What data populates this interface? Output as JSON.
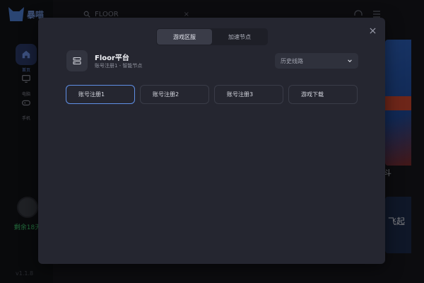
{
  "app": {
    "name": "暴喵",
    "version": "v1.1.8",
    "search_value": "FLOOR",
    "sidebar": [
      {
        "label": "首页",
        "icon": "home-icon",
        "active": true
      },
      {
        "label": "电脑",
        "icon": "monitor-icon",
        "active": false
      },
      {
        "label": "手机",
        "icon": "gamepad-icon",
        "active": false
      }
    ],
    "user_tag": "剩余18天",
    "banner_text": "飞起",
    "banner_side_char": "斗"
  },
  "modal": {
    "tabs": [
      {
        "label": "游戏区服",
        "active": true
      },
      {
        "label": "加速节点",
        "active": false
      }
    ],
    "platform": {
      "name": "Floor平台",
      "subtitle": "账号注册1 - 智能节点",
      "icon": "server-icon"
    },
    "route_select": {
      "value": "历史线路",
      "icon": "chevron-down-icon"
    },
    "options": [
      {
        "label": "账号注册1",
        "selected": true
      },
      {
        "label": "账号注册2",
        "selected": false
      },
      {
        "label": "账号注册3",
        "selected": false
      },
      {
        "label": "游戏下载",
        "selected": false
      }
    ],
    "close_icon": "close-icon"
  },
  "colors": {
    "accent": "#5f8fe6",
    "modal_bg": "#252630",
    "user_tag": "#3ec46d"
  }
}
